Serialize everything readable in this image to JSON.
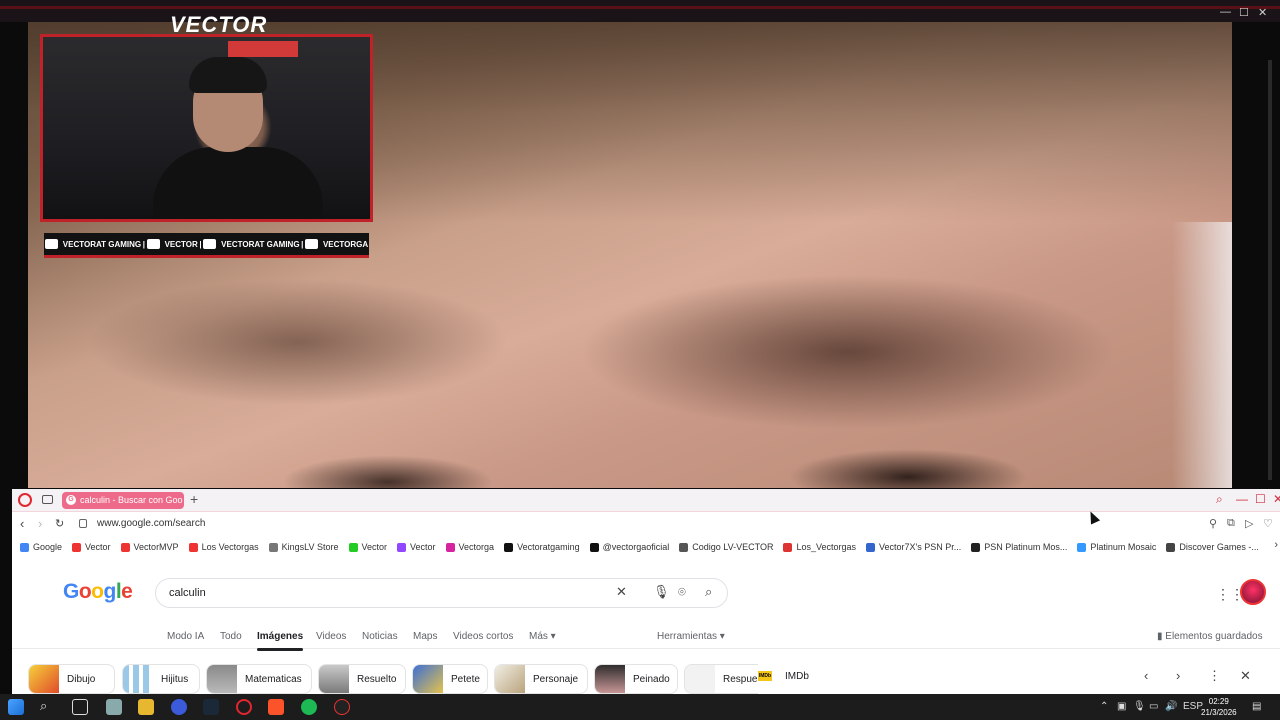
{
  "stream": {
    "brand": "VECTOR",
    "socials": [
      {
        "icon": "youtube-icon",
        "label": "VECTORAT GAMING"
      },
      {
        "icon": "twitch-icon",
        "label": "VECTOR"
      },
      {
        "icon": "twitter-icon",
        "label": "VECTORAT GAMING"
      },
      {
        "icon": "instagram-icon",
        "label": "VECTORGA"
      }
    ]
  },
  "browser": {
    "tab_title": "calculin - Buscar con Goo",
    "url": "www.google.com/search",
    "bookmarks": [
      {
        "label": "Google",
        "color": "#4285f4"
      },
      {
        "label": "Vector",
        "color": "#e33"
      },
      {
        "label": "VectorMVP",
        "color": "#e33"
      },
      {
        "label": "Los Vectorgas",
        "color": "#e33"
      },
      {
        "label": "KingsLV Store",
        "color": "#777"
      },
      {
        "label": "Vector",
        "color": "#2c2"
      },
      {
        "label": "Vector",
        "color": "#9146ff"
      },
      {
        "label": "Vectorga",
        "color": "#d6249f"
      },
      {
        "label": "Vectoratgaming",
        "color": "#111"
      },
      {
        "label": "@vectorgaoficial",
        "color": "#111"
      },
      {
        "label": "Codigo LV-VECTOR",
        "color": "#555"
      },
      {
        "label": "Los_Vectorgas",
        "color": "#d33"
      },
      {
        "label": "Vector7X's PSN Pr...",
        "color": "#36c"
      },
      {
        "label": "PSN Platinum Mos...",
        "color": "#222"
      },
      {
        "label": "Platinum Mosaic",
        "color": "#39f"
      },
      {
        "label": "Discover Games -...",
        "color": "#444"
      }
    ],
    "google": {
      "logo": [
        "G",
        "o",
        "o",
        "g",
        "l",
        "e"
      ],
      "query": "calculin",
      "tabs": [
        "Modo IA",
        "Todo",
        "Imágenes",
        "Videos",
        "Noticias",
        "Maps",
        "Videos cortos",
        "Más ▾",
        "Herramientas ▾"
      ],
      "active_tab": "Imágenes",
      "saved_label": "Elementos guardados",
      "chips": [
        "Dibujo",
        "Hijitus",
        "Matematicas",
        "Resuelto",
        "Petete",
        "Personaje",
        "Peinado",
        "Respue"
      ],
      "imdb_label": "IMDb"
    }
  },
  "taskbar": {
    "language": "ESP",
    "time": "02:29",
    "date": "21/3/2026"
  }
}
